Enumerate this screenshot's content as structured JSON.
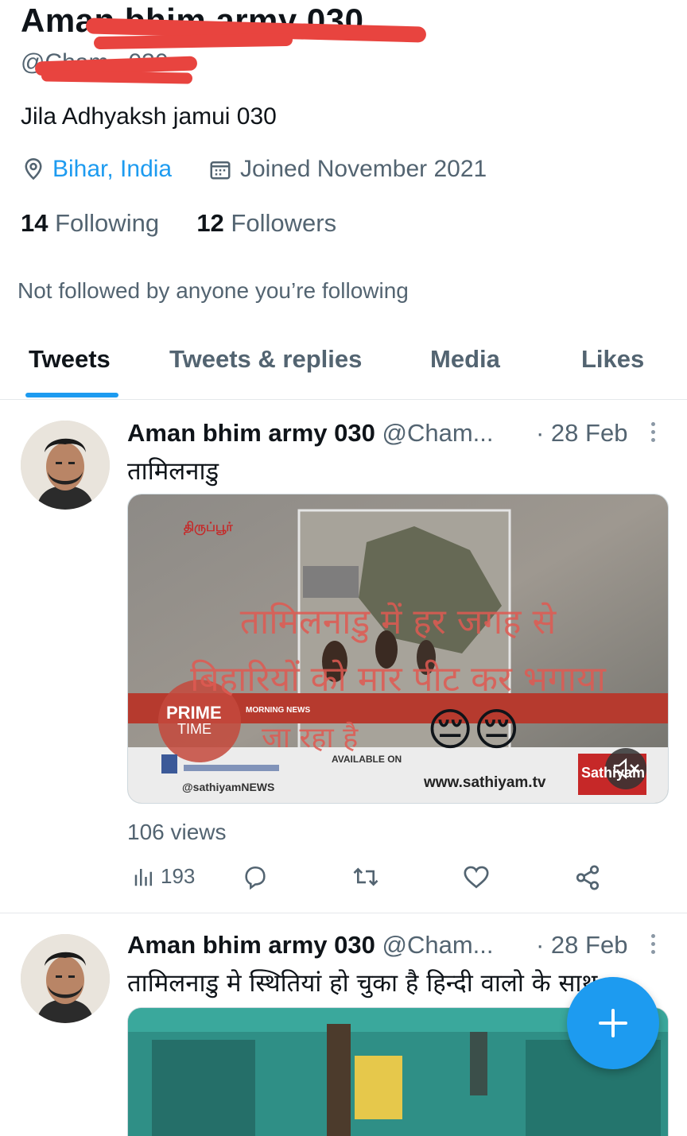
{
  "profile": {
    "display_name": "Aman bhim army 030",
    "handle": "@Cham...030",
    "bio": "Jila Adhyaksh jamui 030",
    "location": "Bihar, India",
    "joined": "Joined November 2021",
    "following_count": "14",
    "following_label": "Following",
    "followers_count": "12",
    "followers_label": "Followers",
    "not_followed_note": "Not followed by anyone you’re following"
  },
  "tabs": [
    {
      "label": "Tweets",
      "active": true
    },
    {
      "label": "Tweets & replies",
      "active": false
    },
    {
      "label": "Media",
      "active": false
    },
    {
      "label": "Likes",
      "active": false
    }
  ],
  "tweets": [
    {
      "author": "Aman bhim army 030",
      "handle": "@Cham...",
      "date": "· 28 Feb",
      "text": "तामिलनाडु",
      "media": {
        "overlay_line1": "तामिलनाडु में हर जगह से",
        "overlay_line2": "बिहारियों को मार पीट कर भगाया",
        "overlay_line3": "जा रहा है",
        "emoji": "😔😔",
        "prime": "PRIME",
        "time": "TIME",
        "morning_news": "MORNING NEWS",
        "available_on": "AVAILABLE ON",
        "social": "@sathiyamNEWS",
        "site": "www.sathiyam.tv",
        "channel": "Sathiyam",
        "location_tag": "திருப்பூர்"
      },
      "views": "106 views",
      "stats_count": "193"
    },
    {
      "author": "Aman bhim army 030",
      "handle": "@Cham...",
      "date": "· 28 Feb",
      "text": "तामिलनाडु मे स्थितियां  हो चुका है हिन्दी वालो के साथ"
    }
  ],
  "icons": {
    "location": "location-pin-icon",
    "calendar": "calendar-icon",
    "stats": "bar-chart-icon",
    "reply": "reply-bubble-icon",
    "retweet": "retweet-icon",
    "like": "heart-icon",
    "share": "share-icon",
    "mute": "speaker-muted-icon",
    "compose": "plus-icon"
  },
  "colors": {
    "accent": "#1d9bf0",
    "redaction": "#e8443f",
    "secondary_text": "#536471"
  }
}
